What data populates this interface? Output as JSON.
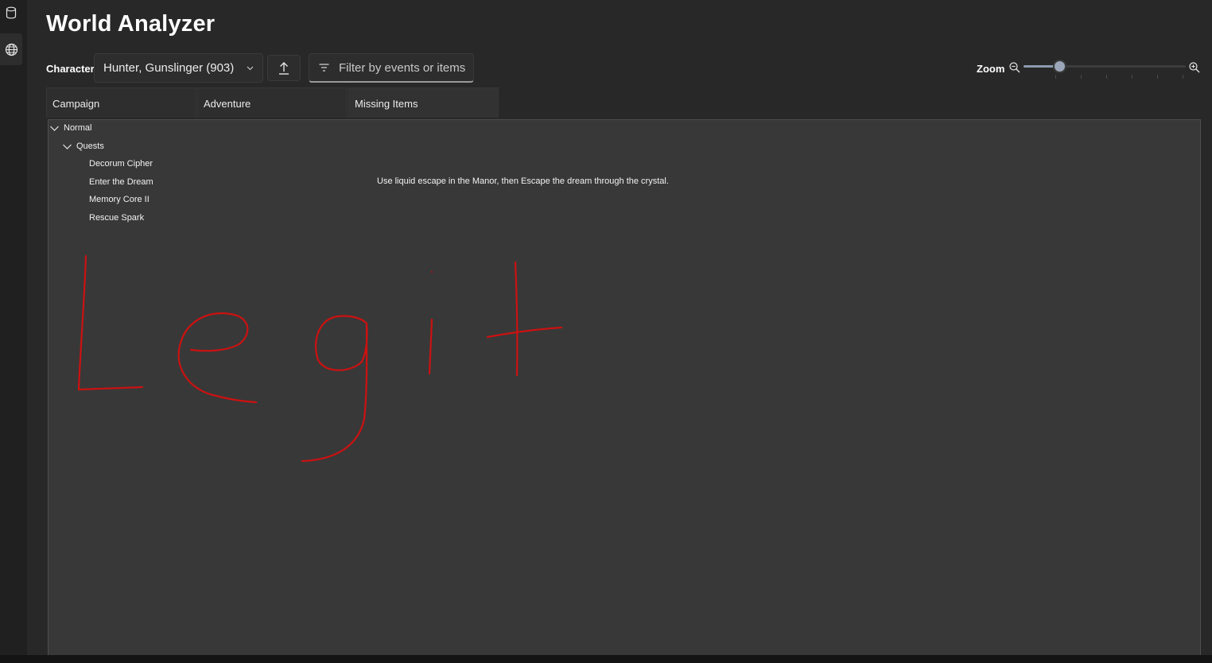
{
  "app": {
    "title": "World Analyzer"
  },
  "nav": {
    "items": [
      {
        "icon": "database-icon"
      },
      {
        "icon": "globe-icon"
      }
    ]
  },
  "toolbar": {
    "character_label": "Character",
    "character_value": "Hunter, Gunslinger (903)",
    "filter_placeholder": "Filter by events or items",
    "zoom_label": "Zoom",
    "zoom_level": 0.2
  },
  "tabs": [
    {
      "label": "Campaign"
    },
    {
      "label": "Adventure"
    },
    {
      "label": "Missing Items"
    }
  ],
  "tree": {
    "root": "Normal",
    "group": "Quests",
    "items": [
      {
        "name": "Decorum Cipher",
        "detail": ""
      },
      {
        "name": "Enter the Dream",
        "detail": "Use liquid escape in the Manor, then Escape the dream through the crystal."
      },
      {
        "name": "Memory Core II",
        "detail": ""
      },
      {
        "name": "Rescue Spark",
        "detail": ""
      }
    ]
  },
  "annotation": {
    "text": "Legit",
    "color": "#cc1111"
  }
}
